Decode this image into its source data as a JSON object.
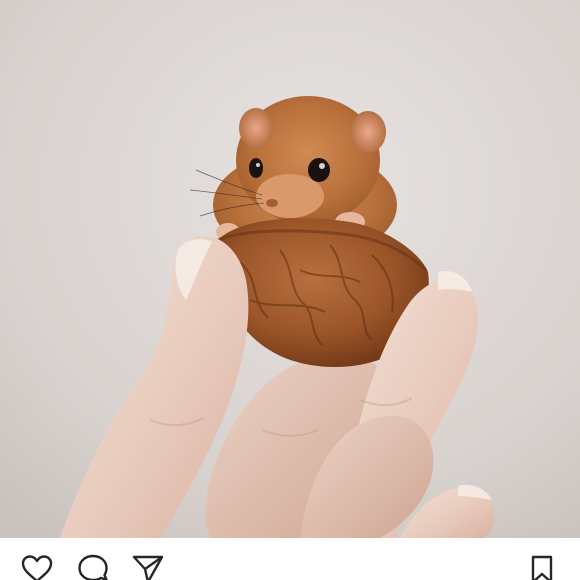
{
  "post": {
    "photo_subject": "",
    "actions": {
      "like_icon": "heart-outline-icon",
      "comment_icon": "speech-bubble-icon",
      "share_icon": "paper-plane-icon",
      "save_icon": "bookmark-outline-icon"
    }
  },
  "colors": {
    "background": "#ffffff",
    "icon_stroke": "#262626",
    "photo_backdrop": "#d9d4d1"
  }
}
